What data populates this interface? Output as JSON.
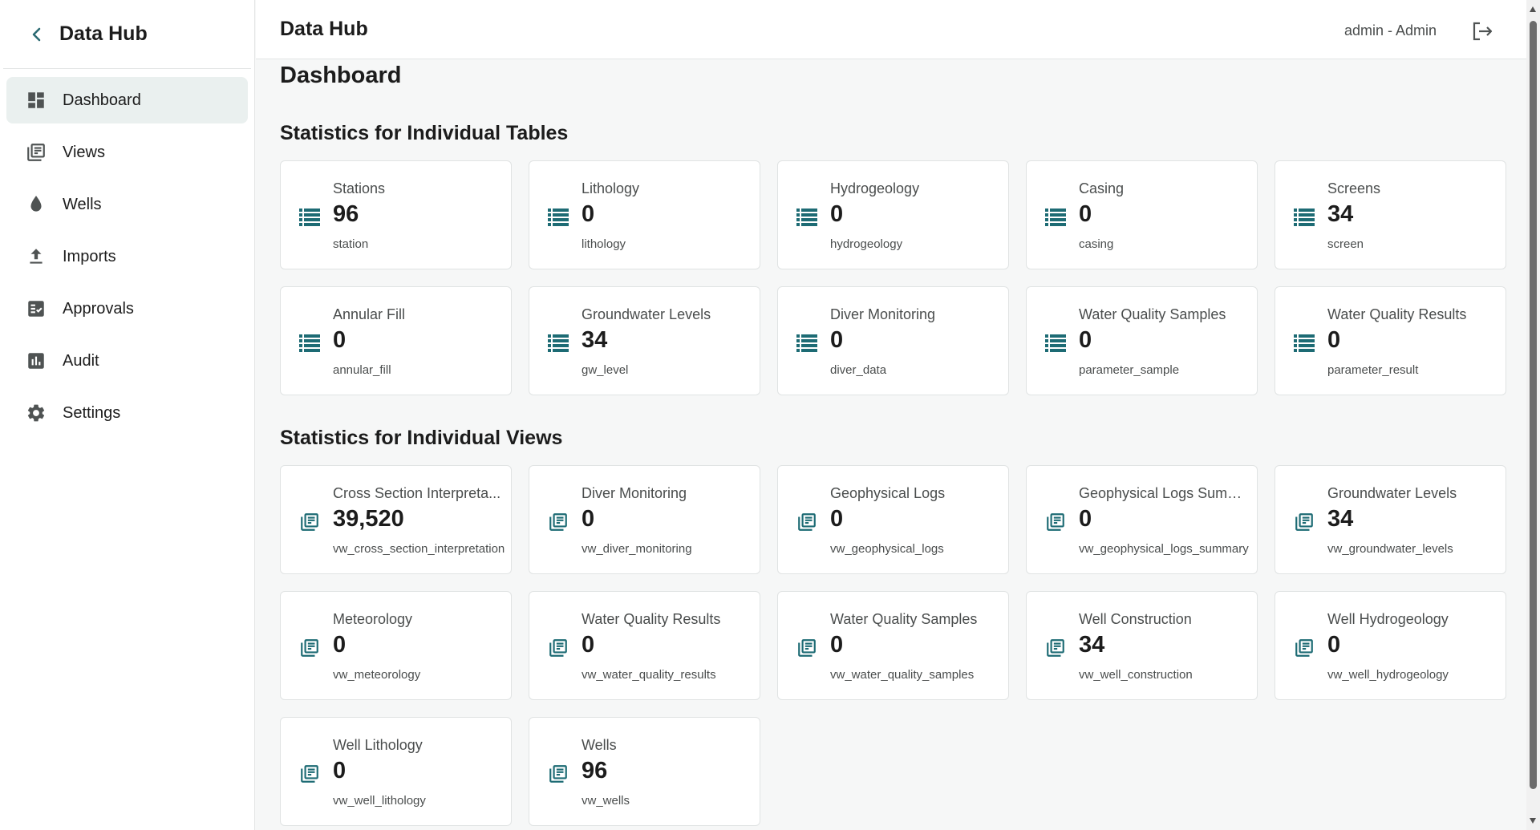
{
  "sidebar": {
    "title": "Data Hub",
    "items": [
      {
        "label": "Dashboard",
        "icon": "dashboard-icon",
        "active": true
      },
      {
        "label": "Views",
        "icon": "views-icon"
      },
      {
        "label": "Wells",
        "icon": "drop-icon"
      },
      {
        "label": "Imports",
        "icon": "upload-icon"
      },
      {
        "label": "Approvals",
        "icon": "approval-icon"
      },
      {
        "label": "Audit",
        "icon": "bar-chart-icon"
      },
      {
        "label": "Settings",
        "icon": "gear-icon"
      }
    ]
  },
  "topbar": {
    "title": "Data Hub",
    "user": "admin - Admin"
  },
  "main": {
    "page_title": "Dashboard",
    "tables_title": "Statistics for Individual Tables",
    "views_title": "Statistics for Individual Views",
    "tables": [
      {
        "label": "Stations",
        "value": "96",
        "name": "station"
      },
      {
        "label": "Lithology",
        "value": "0",
        "name": "lithology"
      },
      {
        "label": "Hydrogeology",
        "value": "0",
        "name": "hydrogeology"
      },
      {
        "label": "Casing",
        "value": "0",
        "name": "casing"
      },
      {
        "label": "Screens",
        "value": "34",
        "name": "screen"
      },
      {
        "label": "Annular Fill",
        "value": "0",
        "name": "annular_fill"
      },
      {
        "label": "Groundwater Levels",
        "value": "34",
        "name": "gw_level"
      },
      {
        "label": "Diver Monitoring",
        "value": "0",
        "name": "diver_data"
      },
      {
        "label": "Water Quality Samples",
        "value": "0",
        "name": "parameter_sample"
      },
      {
        "label": "Water Quality Results",
        "value": "0",
        "name": "parameter_result"
      }
    ],
    "views": [
      {
        "label": "Cross Section Interpreta...",
        "value": "39,520",
        "name": "vw_cross_section_interpretation"
      },
      {
        "label": "Diver Monitoring",
        "value": "0",
        "name": "vw_diver_monitoring"
      },
      {
        "label": "Geophysical Logs",
        "value": "0",
        "name": "vw_geophysical_logs"
      },
      {
        "label": "Geophysical Logs Summ...",
        "value": "0",
        "name": "vw_geophysical_logs_summary"
      },
      {
        "label": "Groundwater Levels",
        "value": "34",
        "name": "vw_groundwater_levels"
      },
      {
        "label": "Meteorology",
        "value": "0",
        "name": "vw_meteorology"
      },
      {
        "label": "Water Quality Results",
        "value": "0",
        "name": "vw_water_quality_results"
      },
      {
        "label": "Water Quality Samples",
        "value": "0",
        "name": "vw_water_quality_samples"
      },
      {
        "label": "Well Construction",
        "value": "34",
        "name": "vw_well_construction"
      },
      {
        "label": "Well Hydrogeology",
        "value": "0",
        "name": "vw_well_hydrogeology"
      },
      {
        "label": "Well Lithology",
        "value": "0",
        "name": "vw_well_lithology"
      },
      {
        "label": "Wells",
        "value": "96",
        "name": "vw_wells"
      }
    ]
  },
  "colors": {
    "accent": "#1d6b74",
    "active_bg": "#eaf0ef",
    "page_bg": "#f6f7f7"
  }
}
